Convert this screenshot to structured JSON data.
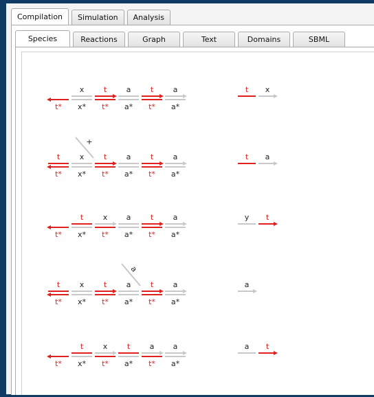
{
  "outer_tabs": [
    "Compilation",
    "Simulation",
    "Analysis"
  ],
  "inner_tabs": [
    "Species",
    "Reactions",
    "Graph",
    "Text",
    "Domains",
    "SBML"
  ],
  "colors": {
    "background": "#0f3a63",
    "toehold": "#e0201e",
    "domain": "#c8c8c8",
    "text": "#222222"
  },
  "reactions": [
    {
      "left_top": [
        "x",
        "t",
        "a",
        "t",
        "a"
      ],
      "left_bottom": [
        "t*",
        "x*",
        "t*",
        "a*",
        "t*",
        "a*"
      ],
      "plus": "",
      "right": [
        "t",
        "x"
      ]
    },
    {
      "left_top": [
        "t",
        "x",
        "t",
        "a",
        "t",
        "a"
      ],
      "left_bottom": [
        "t*",
        "x*",
        "t*",
        "a*",
        "t*",
        "a*"
      ],
      "plus": "+",
      "right": [
        "t",
        "a"
      ]
    },
    {
      "left_top": [
        "t",
        "x",
        "a",
        "t",
        "a"
      ],
      "left_bottom": [
        "t*",
        "x*",
        "t*",
        "a*",
        "t*",
        "a*"
      ],
      "plus": "",
      "right": [
        "y",
        "t"
      ]
    },
    {
      "left_top": [
        "t",
        "x",
        "t",
        "a",
        "t",
        "a"
      ],
      "left_bottom": [
        "t*",
        "x*",
        "t*",
        "a*",
        "t*",
        "a*"
      ],
      "plus": "",
      "branch_label": "a",
      "right": [
        "a"
      ]
    },
    {
      "left_top": [
        "t",
        "x",
        "t",
        "a",
        "a"
      ],
      "left_bottom": [
        "t*",
        "x*",
        "t*",
        "a*",
        "t*",
        "a*"
      ],
      "plus": "",
      "right": [
        "a",
        "t"
      ]
    }
  ]
}
